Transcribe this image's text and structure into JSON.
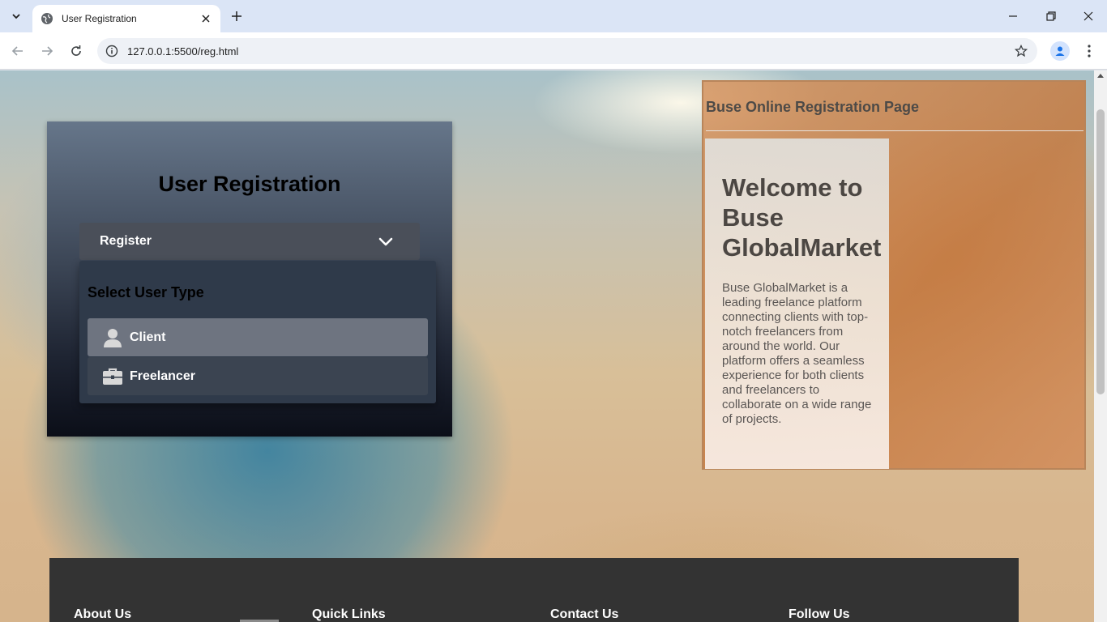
{
  "browser": {
    "tab_title": "User Registration",
    "url": "127.0.0.1:5500/reg.html",
    "icons": {
      "tab_search": "chevron-down-icon",
      "favicon": "globe-icon",
      "close_tab": "close-icon",
      "new_tab": "plus-icon",
      "minimize": "minimize-icon",
      "restore": "restore-icon",
      "close_window": "close-icon",
      "back": "arrow-left-icon",
      "forward": "arrow-right-icon",
      "reload": "reload-icon",
      "site_info": "info-icon",
      "bookmark": "star-icon",
      "profile": "person-icon",
      "menu": "more-vert-icon"
    }
  },
  "registration": {
    "title": "User Registration",
    "dropdown": {
      "label": "Register",
      "menu_title": "Select User Type",
      "items": [
        {
          "label": "Client",
          "icon": "user-icon"
        },
        {
          "label": "Freelancer",
          "icon": "briefcase-icon"
        }
      ]
    }
  },
  "info_panel": {
    "title": "Buse Online Registration Page",
    "welcome_heading": "Welcome to Buse GlobalMarket",
    "description": "Buse GlobalMarket is a leading freelance platform connecting clients with top-notch freelancers from around the world. Our platform offers a seamless experience for both clients and freelancers to collaborate on a wide range of projects."
  },
  "footer": {
    "columns": [
      "About Us",
      "Quick Links",
      "Contact Us",
      "Follow Us"
    ]
  },
  "colors": {
    "card_top": "#66768a",
    "card_bottom": "#0b0e18",
    "menu_bg": "#2f3a4a",
    "client_item": "#6e7480",
    "freelancer_item": "#3b4451",
    "panel_orange": "#c4783e",
    "footer_bg": "#333333"
  }
}
